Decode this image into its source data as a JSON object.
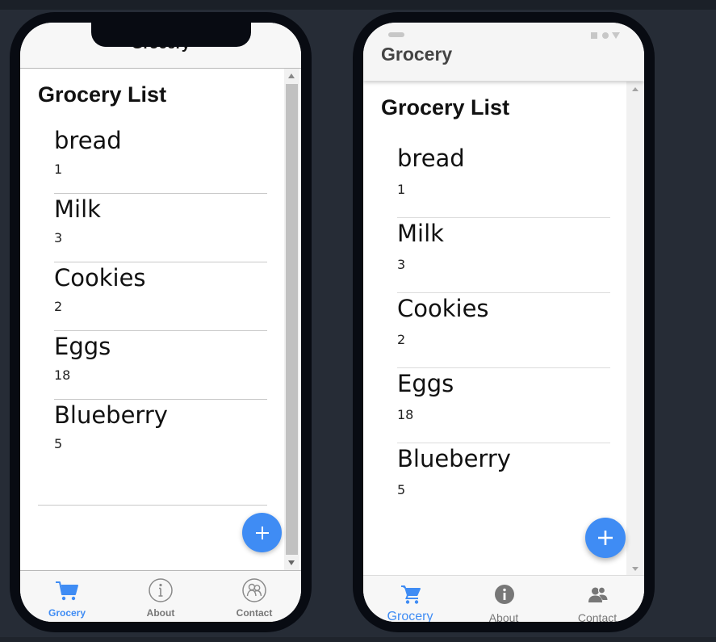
{
  "colors": {
    "accent": "#3f8cf4",
    "background": "#262c36",
    "phone_frame": "#080b12",
    "inactive_tab": "#777777"
  },
  "ios": {
    "header_title": "Grocery",
    "list_title": "Grocery List",
    "items": [
      {
        "name": "bread",
        "qty": "1"
      },
      {
        "name": "Milk",
        "qty": "3"
      },
      {
        "name": "Cookies",
        "qty": "2"
      },
      {
        "name": "Eggs",
        "qty": "18"
      },
      {
        "name": "Blueberry",
        "qty": "5"
      }
    ],
    "fab_icon": "plus-icon",
    "tabs": [
      {
        "label": "Grocery",
        "icon": "cart-icon",
        "active": true
      },
      {
        "label": "About",
        "icon": "info-icon",
        "active": false
      },
      {
        "label": "Contact",
        "icon": "contact-icon",
        "active": false
      }
    ]
  },
  "material": {
    "header_title": "Grocery",
    "list_title": "Grocery List",
    "items": [
      {
        "name": "bread",
        "qty": "1"
      },
      {
        "name": "Milk",
        "qty": "3"
      },
      {
        "name": "Cookies",
        "qty": "2"
      },
      {
        "name": "Eggs",
        "qty": "18"
      },
      {
        "name": "Blueberry",
        "qty": "5"
      }
    ],
    "fab_icon": "plus-icon",
    "tabs": [
      {
        "label": "Grocery",
        "icon": "cart-icon",
        "active": true
      },
      {
        "label": "About",
        "icon": "info-icon",
        "active": false
      },
      {
        "label": "Contact",
        "icon": "contact-icon",
        "active": false
      }
    ]
  }
}
